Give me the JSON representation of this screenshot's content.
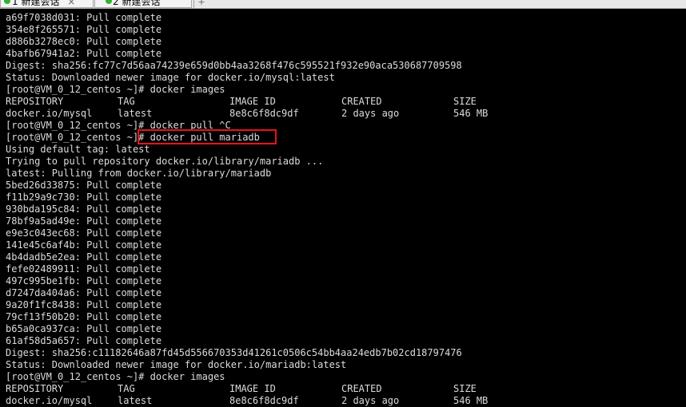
{
  "tabs": [
    {
      "label": "1 新建会话",
      "active": false,
      "status": "connected"
    },
    {
      "label": "2 新建会话",
      "active": true,
      "status": "connected"
    }
  ],
  "tab_new_symbol": "+",
  "tab_close_symbol": "×",
  "colors": {
    "terminal_bg": "#000000",
    "terminal_fg": "#dcdcdc",
    "highlight": "#e8141a",
    "status_dot": "#2db52d"
  },
  "terminal": {
    "lines": [
      "a69f7038d031: Pull complete",
      "354e8f265571: Pull complete",
      "d886b3278ec0: Pull complete",
      "4bafb67941a2: Pull complete",
      "Digest: sha256:fc77c7d56aa74239e659d0bb4aa3268f476c595521f932e90aca530687709598",
      "Status: Downloaded newer image for docker.io/mysql:latest",
      "[root@VM_0_12_centos ~]# docker images",
      {
        "table": [
          "REPOSITORY",
          "TAG",
          "IMAGE ID",
          "CREATED",
          "SIZE"
        ]
      },
      {
        "table": [
          "docker.io/mysql",
          "latest",
          "8e8c6f8dc9df",
          "2 days ago",
          "546 MB"
        ]
      },
      "[root@VM_0_12_centos ~]# docker pull ^C",
      "[root@VM_0_12_centos ~]# docker pull mariadb",
      "Using default tag: latest",
      "Trying to pull repository docker.io/library/mariadb ...",
      "latest: Pulling from docker.io/library/mariadb",
      "5bed26d33875: Pull complete",
      "f11b29a9c730: Pull complete",
      "930bda195c84: Pull complete",
      "78bf9a5ad49e: Pull complete",
      "e9e3c043ec68: Pull complete",
      "141e45c6af4b: Pull complete",
      "4b4dadb5e2ea: Pull complete",
      "fefe02489911: Pull complete",
      "497c995be1fb: Pull complete",
      "d7247da404a6: Pull complete",
      "9a20f1fc8438: Pull complete",
      "79cf13f50b20: Pull complete",
      "b65a0ca937ca: Pull complete",
      "61af58d5a657: Pull complete",
      "Digest: sha256:c11182646a87fd45d556670353d41261c0506c54bb4aa24edb7b02cd18797476",
      "Status: Downloaded newer image for docker.io/mariadb:latest",
      "[root@VM_0_12_centos ~]# docker images",
      {
        "table": [
          "REPOSITORY",
          "TAG",
          "IMAGE ID",
          "CREATED",
          "SIZE"
        ]
      },
      {
        "table": [
          "docker.io/mysql",
          "latest",
          "8e8c6f8dc9df",
          "2 days ago",
          "546 MB"
        ]
      }
    ]
  }
}
